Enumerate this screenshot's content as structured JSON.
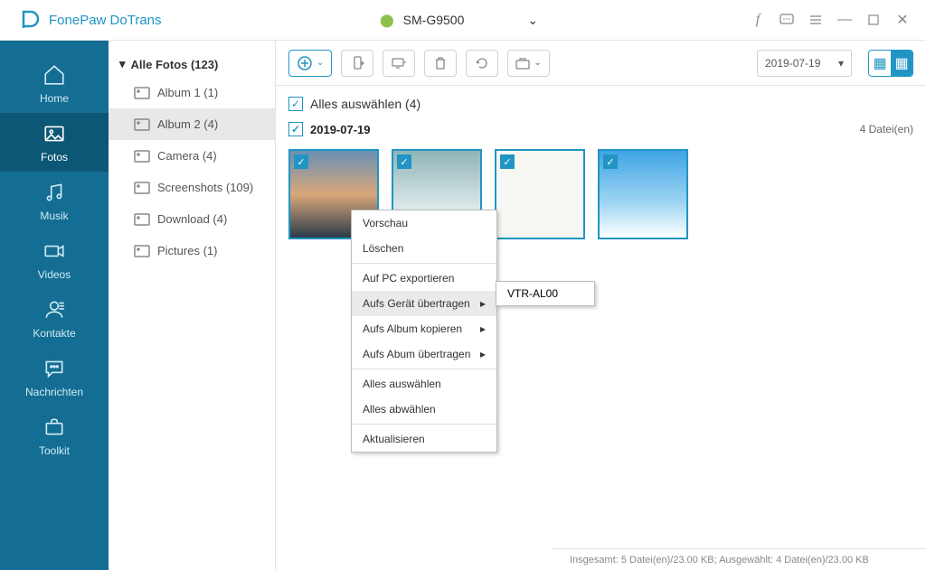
{
  "app": {
    "title": "FonePaw DoTrans"
  },
  "device": {
    "name": "SM-G9500"
  },
  "nav": [
    {
      "label": "Home"
    },
    {
      "label": "Fotos"
    },
    {
      "label": "Musik"
    },
    {
      "label": "Videos"
    },
    {
      "label": "Kontakte"
    },
    {
      "label": "Nachrichten"
    },
    {
      "label": "Toolkit"
    }
  ],
  "albums": {
    "root": "Alle Fotos (123)",
    "items": [
      {
        "label": "Album 1 (1)"
      },
      {
        "label": "Album 2 (4)"
      },
      {
        "label": "Camera (4)"
      },
      {
        "label": "Screenshots (109)"
      },
      {
        "label": "Download (4)"
      },
      {
        "label": "Pictures (1)"
      }
    ]
  },
  "toolbar": {
    "date_filter": "2019-07-19"
  },
  "select_all": "Alles auswählen (4)",
  "group": {
    "date": "2019-07-19",
    "count": "4 Datei(en)"
  },
  "ctx": {
    "preview": "Vorschau",
    "delete": "Löschen",
    "export_pc": "Auf PC exportieren",
    "transfer_device": "Aufs Gerät übertragen",
    "copy_album": "Aufs Album kopieren",
    "transfer_album": "Aufs Abum übertragen",
    "select_all": "Alles auswählen",
    "deselect_all": "Alles abwählen",
    "refresh": "Aktualisieren",
    "sub_device": "VTR-AL00"
  },
  "status": "Insgesamt: 5 Datei(en)/23.00 KB; Ausgewählt: 4 Datei(en)/23.00 KB"
}
